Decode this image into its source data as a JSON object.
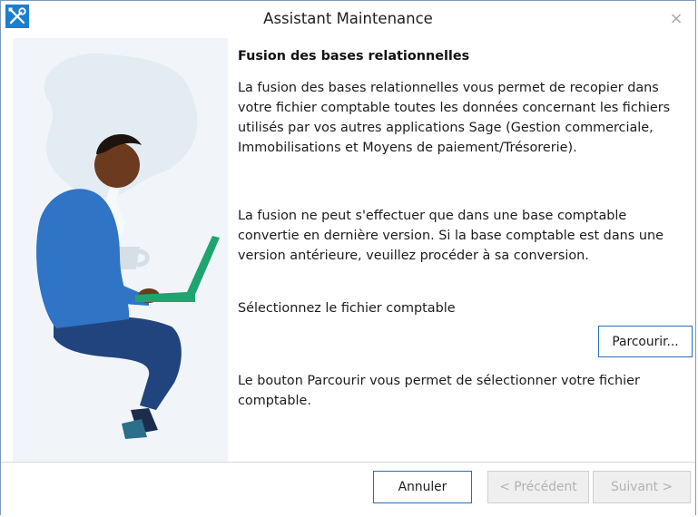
{
  "window": {
    "title": "Assistant Maintenance",
    "close_glyph": "×",
    "app_icon": "tools-icon",
    "accent_color": "#2a6fb5"
  },
  "content": {
    "heading": "Fusion des bases relationnelles",
    "paragraph1": "La fusion des bases relationnelles vous permet de recopier dans votre fichier comptable toutes les données concernant les fichiers utilisés par vos autres applications Sage (Gestion commerciale, Immobilisations et Moyens de paiement/Trésorerie).",
    "paragraph2": "La fusion ne peut s'effectuer que dans une base comptable convertie en dernière version. Si la base comptable est dans une version antérieure, veuillez procéder à sa conversion.",
    "select_label": "Sélectionnez le fichier comptable",
    "browse_label": "Parcourir...",
    "help_text": "Le bouton Parcourir vous permet de sélectionner votre fichier comptable."
  },
  "footer": {
    "cancel_label": "Annuler",
    "previous_label": "< Précédent",
    "next_label": "Suivant >"
  },
  "illustration": {
    "icon": "person-laptop-illustration",
    "laptop_color": "#1fa46f",
    "shirt_color": "#2f74c5"
  }
}
